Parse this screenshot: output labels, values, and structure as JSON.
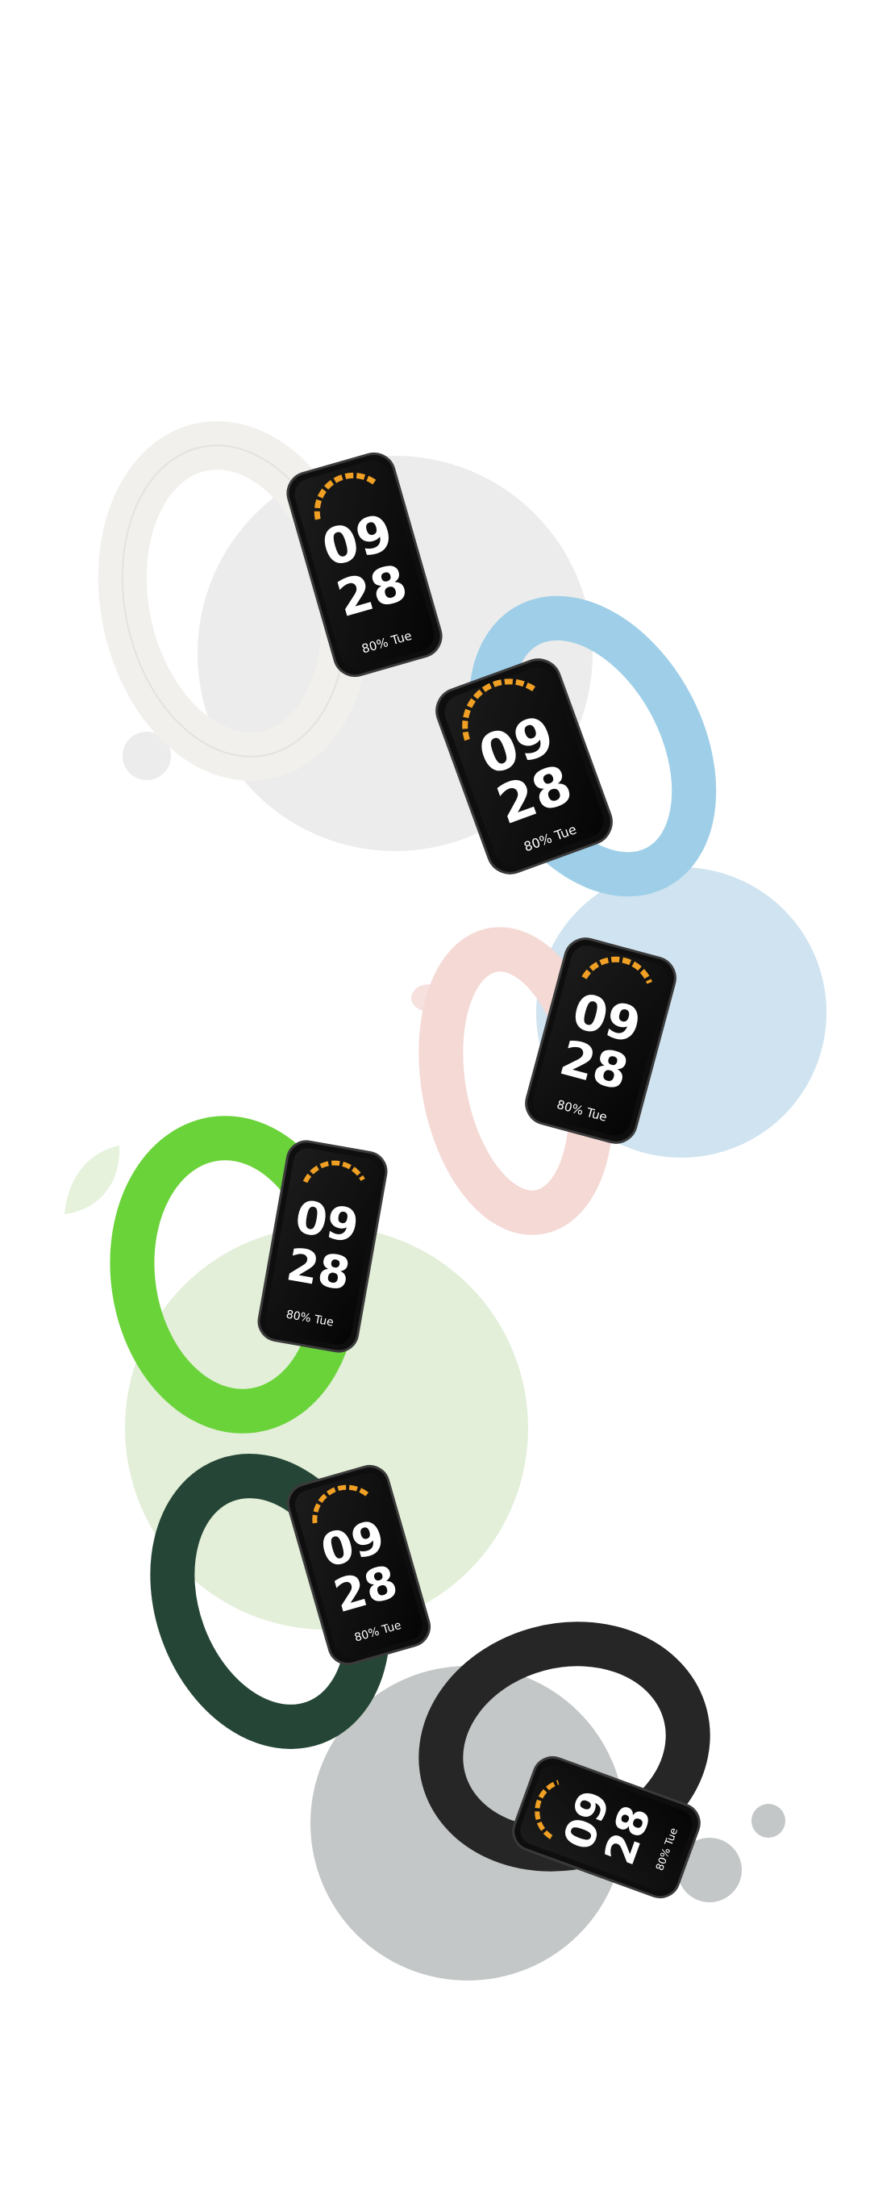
{
  "colors": {
    "bg": "#ffffff",
    "circle_gray": "#ececec",
    "circle_blue": "#cfe3f0",
    "circle_green": "#e3efd9",
    "circle_dark": "#c4c7c7",
    "band_white": "#f1f0ec",
    "band_blue": "#9fcfe8",
    "band_pink": "#f4d9d5",
    "band_green": "#6bd33a",
    "band_darkgreen": "#254636",
    "band_black": "#262626",
    "screen": "#0b0b0b"
  },
  "watches": [
    {
      "name": "white-band-watch",
      "hour": "09",
      "minute": "28",
      "status": "80% Tue"
    },
    {
      "name": "blue-band-watch",
      "hour": "09",
      "minute": "28",
      "status": "80% Tue"
    },
    {
      "name": "pink-band-watch",
      "hour": "09",
      "minute": "28",
      "status": "80% Tue"
    },
    {
      "name": "green-band-watch",
      "hour": "09",
      "minute": "28",
      "status": "80% Tue"
    },
    {
      "name": "dark-green-band-watch",
      "hour": "09",
      "minute": "28",
      "status": "80% Tue"
    },
    {
      "name": "black-band-watch",
      "hour": "09",
      "minute": "28",
      "status": "80% Tue"
    }
  ]
}
